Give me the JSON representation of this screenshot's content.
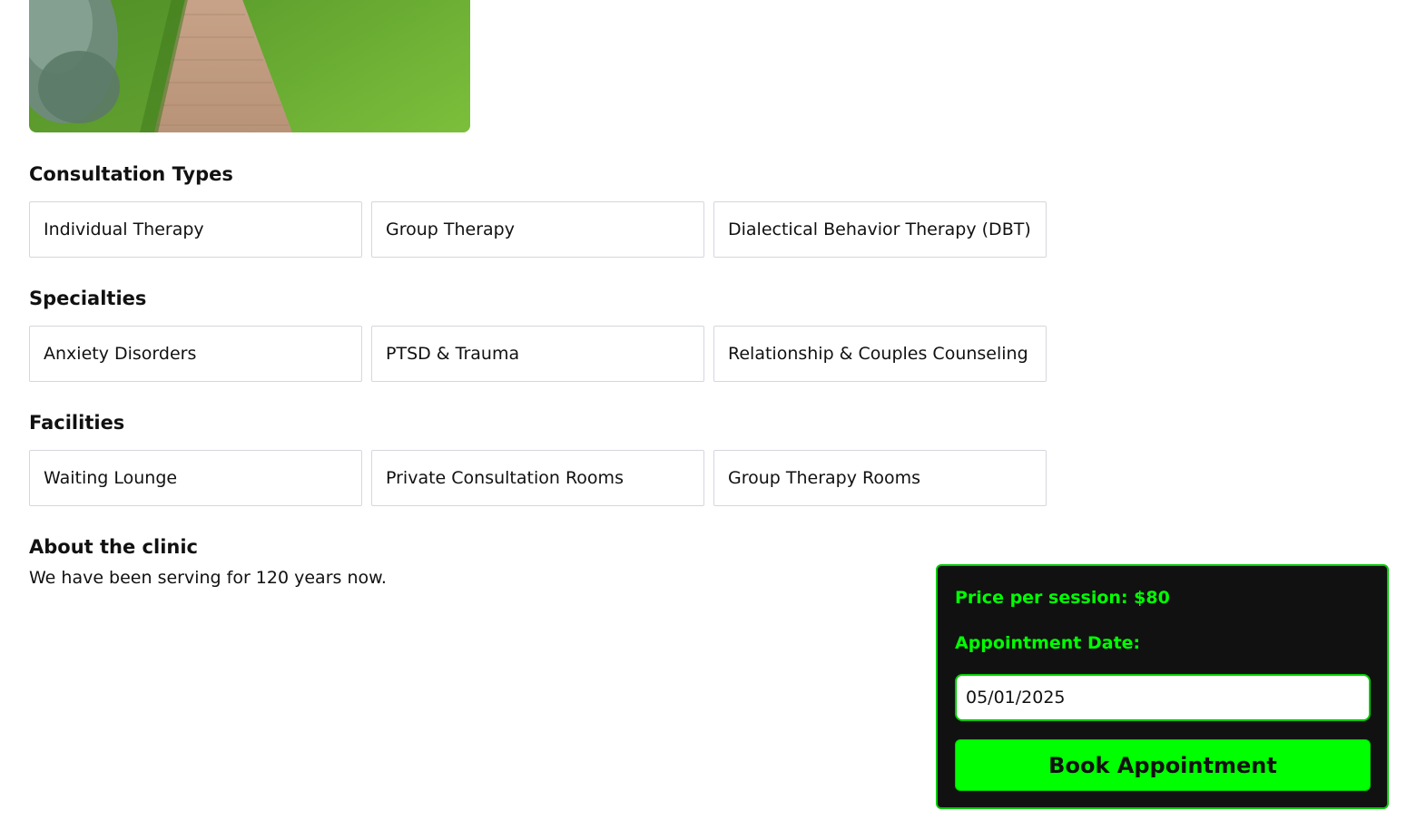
{
  "hero": {
    "image": "garden-path-lawn-photo"
  },
  "consultation": {
    "title": "Consultation Types",
    "items": [
      "Individual Therapy",
      "Group Therapy",
      "Dialectical Behavior Therapy (DBT)"
    ]
  },
  "specialties": {
    "title": "Specialties",
    "items": [
      "Anxiety Disorders",
      "PTSD & Trauma",
      "Relationship & Couples Counseling"
    ]
  },
  "facilities": {
    "title": "Facilities",
    "items": [
      "Waiting Lounge",
      "Private Consultation Rooms",
      "Group Therapy Rooms"
    ]
  },
  "about": {
    "title": "About the clinic",
    "text": "We have been serving for 120 years now."
  },
  "booking": {
    "price_label": "Price per session: $80",
    "date_label": "Appointment Date:",
    "date_value": "05/01/2025",
    "book_label": "Book Appointment"
  },
  "colors": {
    "accent": "#00ff00",
    "panel_bg": "#111111",
    "chip_border": "#d4d7de"
  }
}
